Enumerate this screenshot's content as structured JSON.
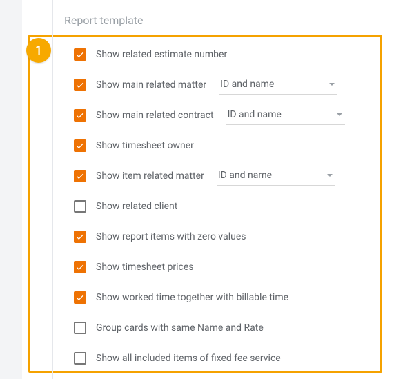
{
  "badge": "1",
  "section_title": "Report template",
  "dropdown_default": "ID and name",
  "options": [
    {
      "label": "Show related estimate number",
      "checked": true,
      "has_select": false
    },
    {
      "label": "Show main related matter",
      "checked": true,
      "has_select": true,
      "select_value": "ID and name"
    },
    {
      "label": "Show main related contract",
      "checked": true,
      "has_select": true,
      "select_value": "ID and name"
    },
    {
      "label": "Show timesheet owner",
      "checked": true,
      "has_select": false
    },
    {
      "label": "Show item related matter",
      "checked": true,
      "has_select": true,
      "select_value": "ID and name"
    },
    {
      "label": "Show related client",
      "checked": false,
      "has_select": false
    },
    {
      "label": "Show report items with zero values",
      "checked": true,
      "has_select": false
    },
    {
      "label": "Show timesheet prices",
      "checked": true,
      "has_select": false
    },
    {
      "label": "Show worked time together with billable time",
      "checked": true,
      "has_select": false
    },
    {
      "label": "Group cards with same Name and Rate",
      "checked": false,
      "has_select": false
    },
    {
      "label": "Show all included items of fixed fee service",
      "checked": false,
      "has_select": false
    }
  ]
}
